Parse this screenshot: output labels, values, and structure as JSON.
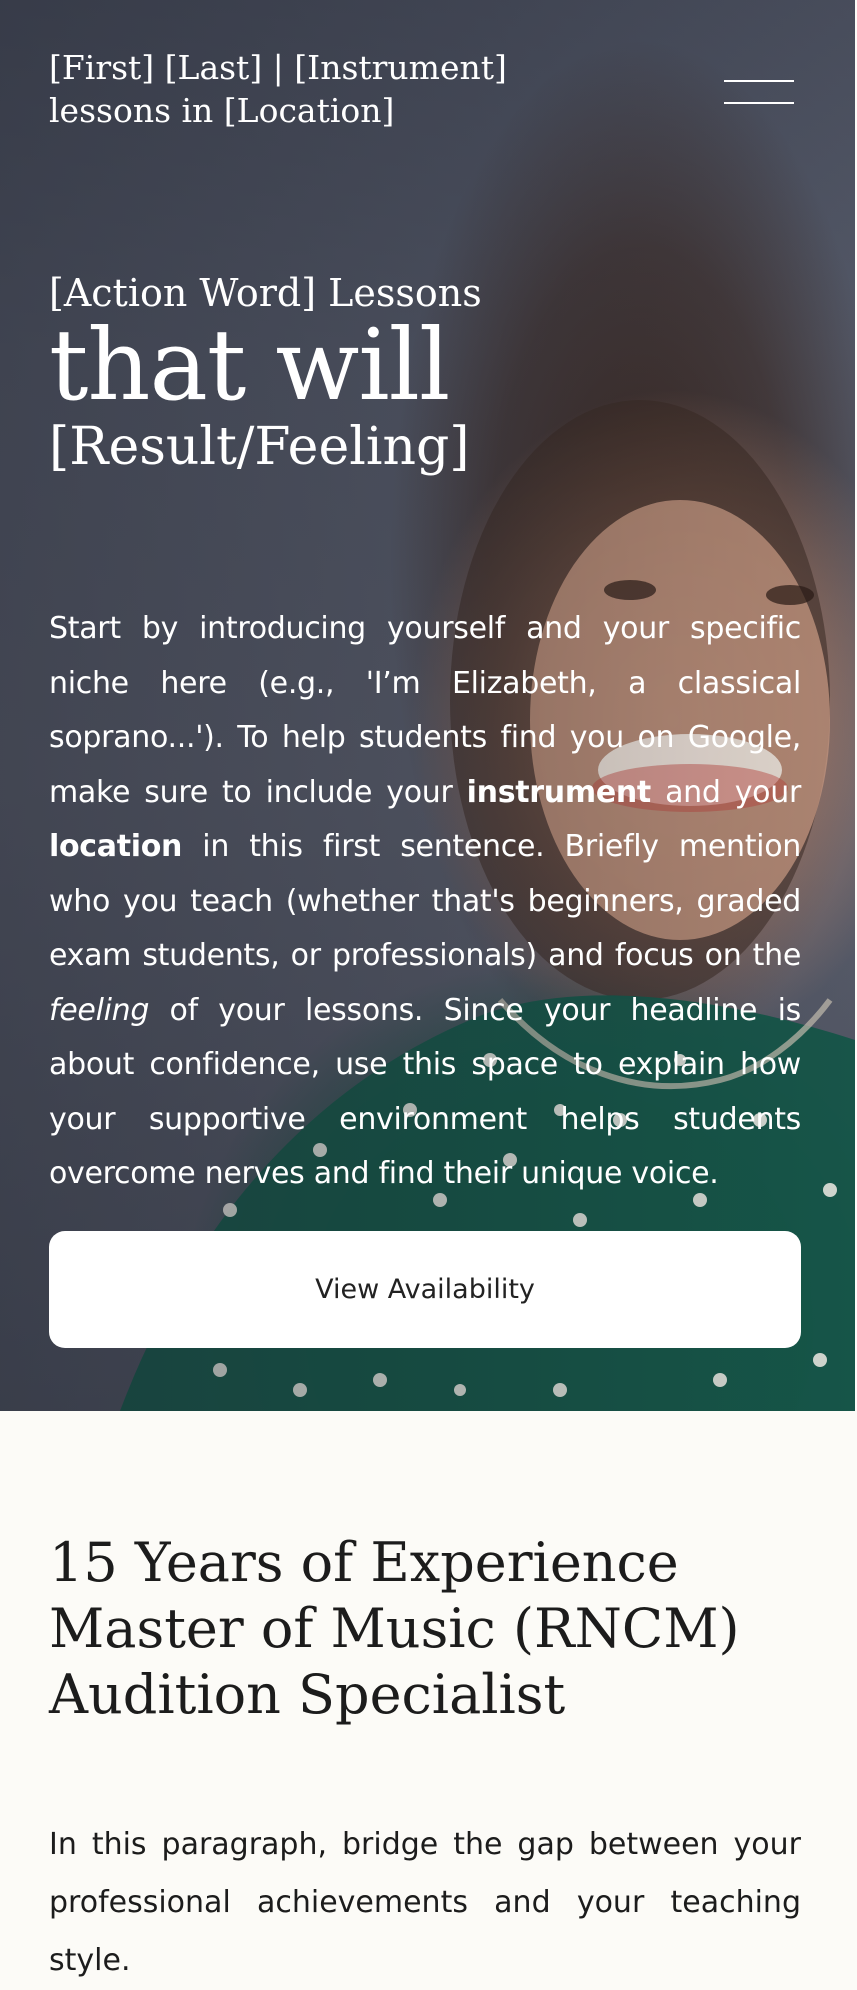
{
  "header": {
    "site_title": "[First] [Last] | [Instrument] lessons in [Location]",
    "menu_icon": "hamburger-menu-icon"
  },
  "hero": {
    "headline_line1": "[Action Word] Lessons",
    "headline_line2": "that will",
    "headline_line3": "[Result/Feeling]",
    "intro": {
      "part1": "Start by introducing yourself and your specific niche here (e.g., 'I’m Elizabeth, a classical soprano...'). To help students find you on Google, make sure to include your ",
      "bold1": "instrument",
      "part2": " and your ",
      "bold2": "location",
      "part3": " in this first sentence. Briefly mention who you teach (whether that's beginners, graded exam students, or professionals) and focus on the ",
      "italic1": "feeling",
      "part4": " of your lessons. Since your headline is about confidence, use this space to explain how your supportive environment helps students overcome nerves and find their unique voice."
    },
    "cta_label": "View Availability",
    "photo_description_colors": {
      "backdrop": "#565b6a",
      "shirt": "#145848",
      "dots": "#f2f2ec"
    }
  },
  "credentials": {
    "line1": "15 Years of Experience",
    "line2": "Master of Music (RNCM)",
    "line3": "Audition Specialist"
  },
  "about": {
    "paragraph": "In this paragraph, bridge the gap between your professional achievements and your teaching style."
  }
}
